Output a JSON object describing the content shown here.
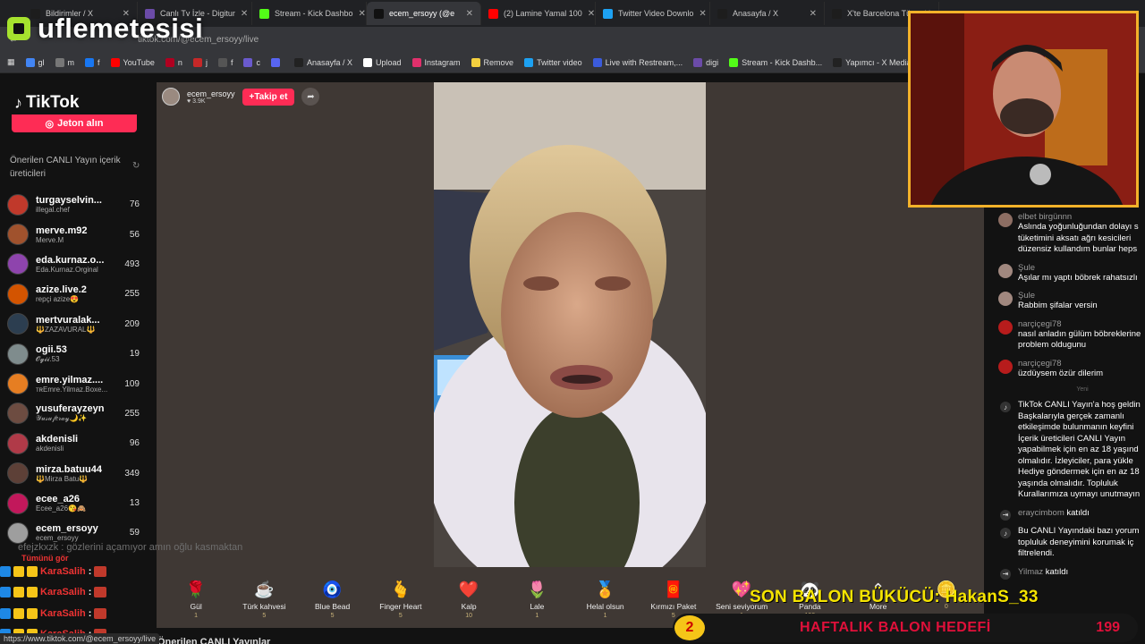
{
  "browser": {
    "tabs": [
      {
        "label": "Bildirimler / X",
        "color": "#1d1d1d"
      },
      {
        "label": "Canlı Tv İzle - Digitur",
        "color": "#6b4ba8"
      },
      {
        "label": "Stream - Kick Dashbo",
        "color": "#53fc18"
      },
      {
        "label": "ecem_ersoyy (@e",
        "color": "#111111",
        "active": true
      },
      {
        "label": "(2) Lamine Yamal 100",
        "color": "#ff0000"
      },
      {
        "label": "Twitter Video Downlo",
        "color": "#1da1f2"
      },
      {
        "label": "Anasayfa / X",
        "color": "#1d1d1d"
      },
      {
        "label": "X'te Barcelona Tü",
        "color": "#1d1d1d"
      }
    ],
    "url": "tiktok.com/@ecem_ersoyy/live",
    "bookmarks": [
      {
        "label": "gl",
        "color": "#4285f4"
      },
      {
        "label": "m",
        "color": "#777777"
      },
      {
        "label": "f",
        "color": "#1877f2"
      },
      {
        "label": "YouTube",
        "color": "#ff0000"
      },
      {
        "label": "n",
        "color": "#b00020"
      },
      {
        "label": "j",
        "color": "#c62828"
      },
      {
        "label": "f",
        "color": "#555555"
      },
      {
        "label": "c",
        "color": "#6a5acd"
      },
      {
        "label": "",
        "color": "#5865f2"
      },
      {
        "label": "Anasayfa / X",
        "color": "#222222"
      },
      {
        "label": "Upload",
        "color": "#ffffff"
      },
      {
        "label": "Instagram",
        "color": "#e1306c"
      },
      {
        "label": "Remove",
        "color": "#f4d03f"
      },
      {
        "label": "Twitter video",
        "color": "#1da1f2"
      },
      {
        "label": "Live with Restream,...",
        "color": "#3b5bdb"
      },
      {
        "label": "digi",
        "color": "#6b4ba8"
      },
      {
        "label": "Stream - Kick Dashb...",
        "color": "#53fc18"
      },
      {
        "label": "Yapımcı - X Media S...",
        "color": "#222222"
      }
    ]
  },
  "overlay": {
    "title": "uflemetesisi"
  },
  "sidebar": {
    "logo": "TikTok",
    "jeton_button": "Jeton alın",
    "recommended_title": "Önerilen CANLI Yayın içerik üreticileri",
    "creators": [
      {
        "username": "turgayselvin...",
        "sub": "illegal.chef",
        "count": "76",
        "color": "#c0392b"
      },
      {
        "username": "merve.m92",
        "sub": "Merve.M",
        "count": "56",
        "color": "#a0522d"
      },
      {
        "username": "eda.kurnaz.o...",
        "sub": "Eda.Kurnaz.Orginal",
        "count": "493",
        "color": "#8e44ad"
      },
      {
        "username": "azize.live.2",
        "sub": "repçi azize😍",
        "count": "255",
        "color": "#d35400"
      },
      {
        "username": "mertvuralak...",
        "sub": "🔱ZAZAVURAL🔱",
        "count": "209",
        "color": "#2c3e50"
      },
      {
        "username": "ogii.53",
        "sub": "𝓞𝓰𝓲𝓲.53",
        "count": "19",
        "color": "#7f8c8d"
      },
      {
        "username": "emre.yilmaz....",
        "sub": "ᴛʀEmre.Yilmaz.Boxe...",
        "count": "109",
        "color": "#e67e22"
      },
      {
        "username": "yusuferayzeyn",
        "sub": "𝒴𝓊𝓈𝓊𝒻𝑒𝓇𝒶𝓎🌙✨",
        "count": "255",
        "color": "#6d4c41"
      },
      {
        "username": "akdenisli",
        "sub": "akdenisli",
        "count": "96",
        "color": "#b03a48"
      },
      {
        "username": "mirza.batuu44",
        "sub": "🔱Mirza Batu🔱",
        "count": "349",
        "color": "#5d4037"
      },
      {
        "username": "ecee_a26",
        "sub": "Ecee_a26😘🙈",
        "count": "13",
        "color": "#c2185b"
      },
      {
        "username": "ecem_ersoyy",
        "sub": "ecem_ersoyy",
        "count": "59",
        "color": "#9e9e9e"
      }
    ],
    "see_all": "Tümünü gör",
    "ghost_chat": "efejzkxzk : gözlerini açamıyor amın oğlu kasmaktan",
    "overlay_chat": [
      {
        "user": "KaraSalih",
        "text": ":"
      },
      {
        "user": "KaraSalih",
        "text": ":"
      },
      {
        "user": "KaraSalih",
        "text": ":"
      },
      {
        "user": "KaraSalih",
        "text": ":"
      }
    ],
    "status_url": "https://www.tiktok.com/@ecem_ersoyy/live"
  },
  "stage": {
    "host_name": "ecem_ersoyy",
    "host_likes": "3.9K",
    "follow_label": "+Takip et",
    "gifts": [
      {
        "name": "Gül",
        "price": "1",
        "icon": "🌹"
      },
      {
        "name": "Türk kahvesi",
        "price": "5",
        "icon": "☕"
      },
      {
        "name": "Blue Bead",
        "price": "5",
        "icon": "🧿"
      },
      {
        "name": "Finger Heart",
        "price": "5",
        "icon": "🫰"
      },
      {
        "name": "Kalp",
        "price": "10",
        "icon": "❤️"
      },
      {
        "name": "Lale",
        "price": "1",
        "icon": "🌷"
      },
      {
        "name": "Helal olsun",
        "price": "1",
        "icon": "🏅"
      },
      {
        "name": "Kırmızı Paket",
        "price": "5",
        "icon": "🧧"
      },
      {
        "name": "Seni seviyorum",
        "price": "1",
        "icon": "💖"
      },
      {
        "name": "Panda",
        "price": "199",
        "icon": "🐼"
      },
      {
        "name": "More",
        "price": "",
        "icon": "⌃"
      },
      {
        "name": "",
        "price": "0",
        "icon": "🪙"
      }
    ],
    "recommended_live": "Önerilen CANLI Yayınlar"
  },
  "chat": {
    "messages": [
      {
        "user": "elbet birgünnn",
        "text": [
          "Aslında yoğunluğundan dolayı s",
          "tüketimini aksatı ağrı kesicileri",
          "düzensiz kullandım bunlar heps"
        ],
        "color": "#8d6e63"
      },
      {
        "user": "Şule",
        "text": [
          "Aşılar mı yaptı böbrek rahatsızlı"
        ],
        "color": "#a1887f"
      },
      {
        "user": "Şule",
        "text": [
          "Rabbim şifalar versin"
        ],
        "color": "#a1887f"
      },
      {
        "user": "narçiçegi78",
        "text": [
          "nasıl anladın gülüm böbreklerine",
          "problem oldugunu"
        ],
        "color": "#b71c1c"
      },
      {
        "user": "narçiçegi78",
        "text": [
          "üzdüysem özür dilerim"
        ],
        "color": "#b71c1c"
      }
    ],
    "divider": "Yeni",
    "system_message": [
      "TikTok CANLI Yayın'a hoş geldin",
      "Başkalarıyla gerçek zamanlı",
      "etkileşimde bulunmanın keyfini",
      "İçerik üreticileri CANLI Yayın",
      "yapabilmek için en az 18 yaşınd",
      "olmalıdır. İzleyiciler, para yükle",
      "Hediye göndermek için en az 18",
      "yaşında olmalıdır. Topluluk",
      "Kurallarımıza uymayı unutmayın"
    ],
    "join_user": "eraycimbom",
    "join_text": "katıldı",
    "notice": [
      "Bu CANLI Yayındaki bazı yorum",
      "topluluk deneyimini korumak iç",
      "filtrelendi."
    ],
    "join2_user": "Yilmaz",
    "join2_text": "katıldı"
  },
  "bottom": {
    "balon_text": "SON BALON BÜKÜCÜ: HakanS_33",
    "hedef_number": "2",
    "hedef_label": "HAFTALIK BALON HEDEFİ",
    "hedef_value": "199"
  }
}
